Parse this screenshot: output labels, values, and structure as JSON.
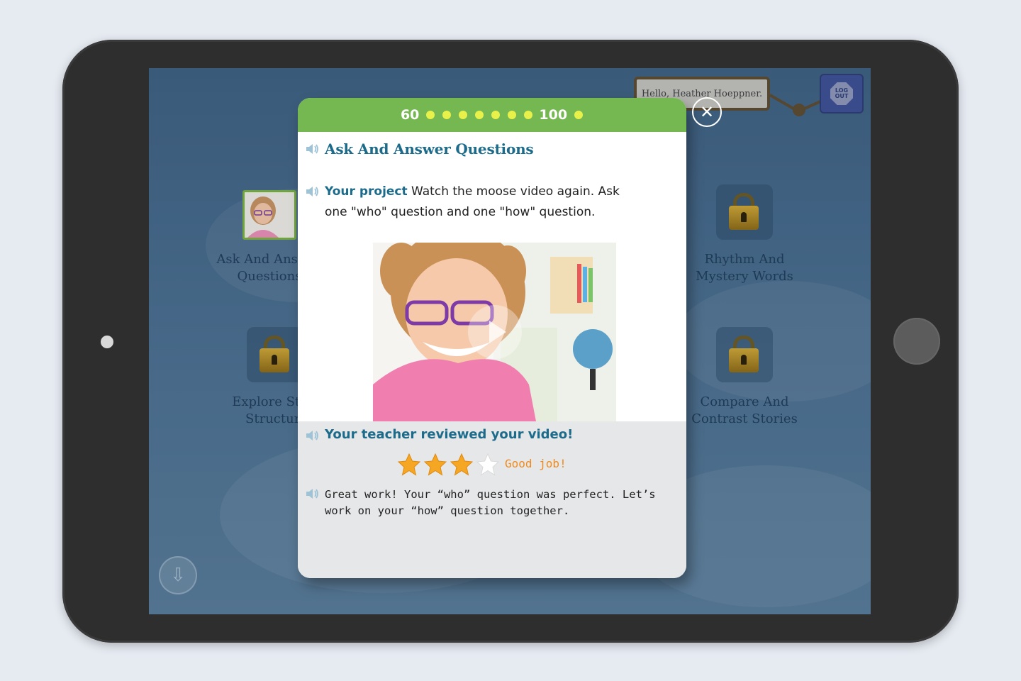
{
  "header": {
    "greeting": "Hello, Heather Hoeppner.",
    "logout_line1": "LOG",
    "logout_line2": "OUT"
  },
  "lessons": [
    {
      "label_line1": "Ask And Answer",
      "label_line2": "Questions",
      "locked": false
    },
    {
      "label_line1": "Rhythm And",
      "label_line2": "Mystery Words",
      "locked": true
    },
    {
      "label_line1": "Explore Story",
      "label_line2": "Structure",
      "locked": true
    },
    {
      "label_line1": "Compare And",
      "label_line2": "Contrast Stories",
      "locked": true
    }
  ],
  "modal": {
    "progress": {
      "start": "60",
      "end": "100",
      "dots_between": 7,
      "dots_after": 1
    },
    "title": "Ask And Answer Questions",
    "project_label": "Your project",
    "project_text": " Watch the moose video again. Ask one \"who\" question and one \"how\" question.",
    "review_heading": "Your teacher reviewed your video!",
    "rating": 3,
    "rating_max": 4,
    "rating_label": "Good job!",
    "teacher_comment": "Great work! Your “who” question was perfect. Let’s work on your “how” question together."
  },
  "colors": {
    "progress_green": "#75b852",
    "dot_yellow": "#e8f04a",
    "title_blue": "#1c6b8a",
    "star_orange": "#f5a623",
    "rating_orange": "#f08a1c"
  },
  "icons": [
    "speaker-icon",
    "play-icon",
    "close-icon",
    "lock-icon",
    "down-arrow-icon",
    "star-icon"
  ]
}
